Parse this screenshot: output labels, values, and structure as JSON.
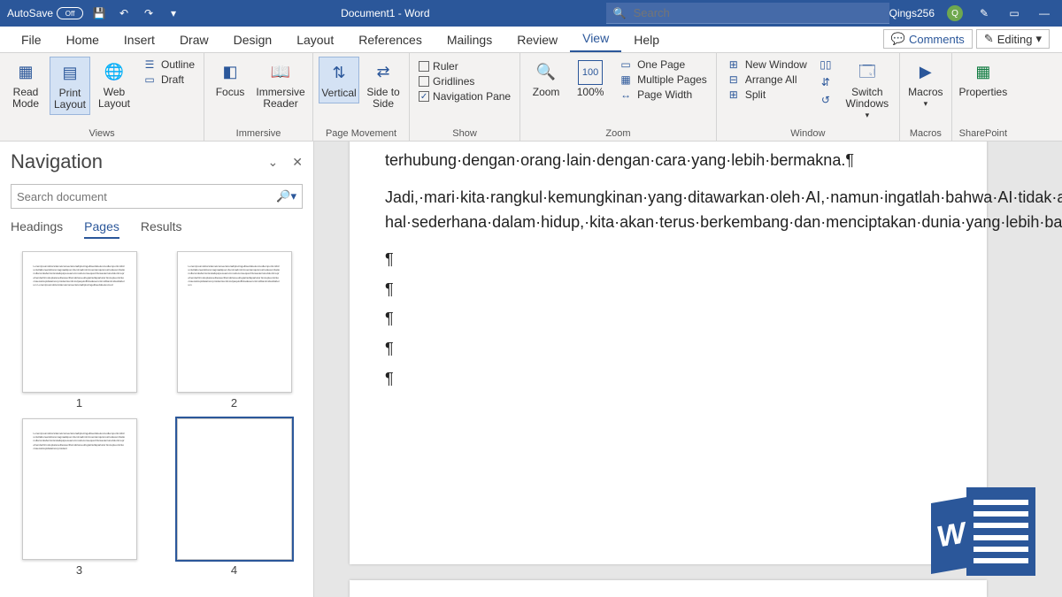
{
  "titlebar": {
    "autosave_label": "AutoSave",
    "autosave_state": "Off",
    "doc_title": "Document1 - Word",
    "search_placeholder": "Search",
    "username": "Qings256",
    "avatar_initial": "Q"
  },
  "menutabs": [
    "File",
    "Home",
    "Insert",
    "Draw",
    "Design",
    "Layout",
    "References",
    "Mailings",
    "Review",
    "View",
    "Help"
  ],
  "menutabs_active": "View",
  "top_buttons": {
    "comments": "Comments",
    "editing": "Editing"
  },
  "ribbon": {
    "views": {
      "label": "Views",
      "read": "Read Mode",
      "print": "Print Layout",
      "web": "Web Layout",
      "outline": "Outline",
      "draft": "Draft"
    },
    "immersive": {
      "label": "Immersive",
      "focus": "Focus",
      "reader": "Immersive Reader"
    },
    "pagemove": {
      "label": "Page Movement",
      "vert": "Vertical",
      "side": "Side to Side"
    },
    "show": {
      "label": "Show",
      "ruler": "Ruler",
      "gridlines": "Gridlines",
      "nav": "Navigation Pane",
      "nav_checked": true
    },
    "zoom": {
      "label": "Zoom",
      "zoom": "Zoom",
      "pct": "100%",
      "one": "One Page",
      "multi": "Multiple Pages",
      "width": "Page Width"
    },
    "window": {
      "label": "Window",
      "neww": "New Window",
      "arr": "Arrange All",
      "split": "Split",
      "switch": "Switch Windows"
    },
    "macros": {
      "label": "Macros",
      "btn": "Macros"
    },
    "sp": {
      "label": "SharePoint",
      "btn": "Properties"
    }
  },
  "nav": {
    "title": "Navigation",
    "search_placeholder": "Search document",
    "tabs": [
      "Headings",
      "Pages",
      "Results"
    ],
    "tabs_active": "Pages",
    "pages": [
      "1",
      "2",
      "3",
      "4"
    ],
    "selected": "4"
  },
  "doc": {
    "p1": "terhubung·dengan·orang·lain·dengan·cara·yang·lebih·bermakna.¶",
    "p2": "Jadi,·mari·kita·rangkul·kemungkinan·yang·ditawarkan·oleh·AI,·namun·ingatlah·bahwa·AI·tidak·akan·pernah·menggantikan·sentuhan·manusia.·Selama·kita·mempertahankan·kreativitas,·emosi,·empati,·dan·apresiasi·kita·terhadap·hal-hal·sederhana·dalam·hidup,·kita·akan·terus·berkembang·dan·menciptakan·dunia·yang·lebih·baik·untuk·diri·kita·sendiri·dan·generasi·mendatang.¶",
    "para": "¶"
  }
}
